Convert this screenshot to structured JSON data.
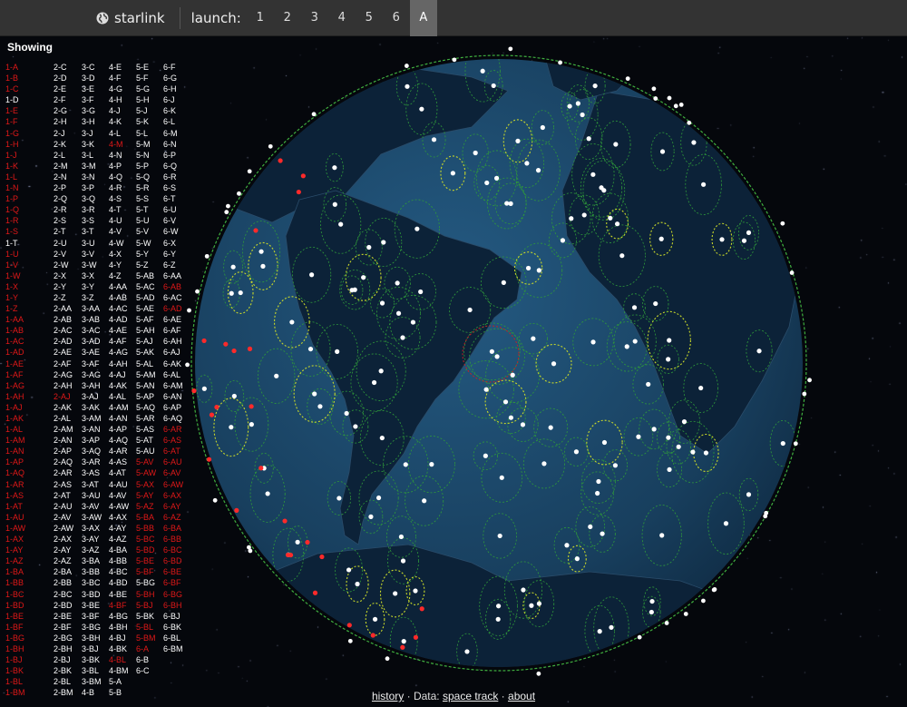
{
  "header": {
    "brand": "starlink",
    "launch_label": "launch:",
    "launch_buttons": [
      "1",
      "2",
      "3",
      "4",
      "5",
      "6",
      "A"
    ],
    "active_launch": "A"
  },
  "sidebar": {
    "heading": "Showing"
  },
  "satellite_columns": [
    [
      "1-A",
      "1-B",
      "1-C",
      "1-D",
      "1-E",
      "1-F",
      "1-G",
      "1-H",
      "1-J",
      "1-K",
      "1-L",
      "1-N",
      "1-P",
      "1-Q",
      "1-R",
      "1-S",
      "1-T",
      "1-U",
      "1-V",
      "1-W",
      "1-X",
      "1-Y",
      "1-Z",
      "1-AA",
      "1-AB",
      "1-AC",
      "1-AD",
      "1-AE",
      "1-AF",
      "1-AG",
      "1-AH",
      "1-AJ",
      "1-AK",
      "1-AL",
      "1-AM",
      "1-AN",
      "1-AP",
      "1-AQ",
      "1-AR",
      "1-AS",
      "1-AT",
      "1-AU",
      "1-AW",
      "1-AX",
      "1-AY",
      "1-AZ",
      "1-BA",
      "1-BB",
      "1-BC",
      "1-BD",
      "1-BE",
      "1-BF",
      "1-BG",
      "1-BH",
      "1-BJ",
      "1-BK",
      "1-BL",
      "1-BM"
    ],
    [
      "2-C",
      "2-D",
      "2-E",
      "2-F",
      "2-G",
      "2-H",
      "2-J",
      "2-K",
      "2-L",
      "2-M",
      "2-N",
      "2-P",
      "2-Q",
      "2-R",
      "2-S",
      "2-T",
      "2-U",
      "2-V",
      "2-W",
      "2-X",
      "2-Y",
      "2-Z",
      "2-AA",
      "2-AB",
      "2-AC",
      "2-AD",
      "2-AE",
      "2-AF",
      "2-AG",
      "2-AH",
      "2-AJ",
      "2-AK",
      "2-AL",
      "2-AM",
      "2-AN",
      "2-AP",
      "2-AQ",
      "2-AR",
      "2-AS",
      "2-AT",
      "2-AU",
      "2-AV",
      "2-AW",
      "2-AX",
      "2-AY",
      "2-AZ",
      "2-BA",
      "2-BB",
      "2-BC",
      "2-BD",
      "2-BE",
      "2-BF",
      "2-BG",
      "2-BH",
      "2-BJ",
      "2-BK",
      "2-BL",
      "2-BM"
    ],
    [
      "3-C",
      "3-D",
      "3-E",
      "3-F",
      "3-G",
      "3-H",
      "3-J",
      "3-K",
      "3-L",
      "3-M",
      "3-N",
      "3-P",
      "3-Q",
      "3-R",
      "3-S",
      "3-T",
      "3-U",
      "3-V",
      "3-W",
      "3-X",
      "3-Y",
      "3-Z",
      "3-AA",
      "3-AB",
      "3-AC",
      "3-AD",
      "3-AE",
      "3-AF",
      "3-AG",
      "3-AH",
      "3-AJ",
      "3-AK",
      "3-AM",
      "3-AN",
      "3-AP",
      "3-AQ",
      "3-AR",
      "3-AS",
      "3-AT",
      "3-AU",
      "3-AV",
      "3-AW",
      "3-AX",
      "3-AY",
      "3-AZ",
      "3-BA",
      "3-BB",
      "3-BC",
      "3-BD",
      "3-BE",
      "3-BF",
      "3-BG",
      "3-BH",
      "3-BJ",
      "3-BK",
      "3-BL",
      "3-BM",
      "4-B"
    ],
    [
      "4-E",
      "4-F",
      "4-G",
      "4-H",
      "4-J",
      "4-K",
      "4-L",
      "4-M",
      "4-N",
      "4-P",
      "4-Q",
      "4-R",
      "4-S",
      "4-T",
      "4-U",
      "4-V",
      "4-W",
      "4-X",
      "4-Y",
      "4-Z",
      "4-AA",
      "4-AB",
      "4-AC",
      "4-AD",
      "4-AE",
      "4-AF",
      "4-AG",
      "4-AH",
      "4-AJ",
      "4-AK",
      "4-AL",
      "4-AM",
      "4-AN",
      "4-AP",
      "4-AQ",
      "4-AR",
      "4-AS",
      "4-AT",
      "4-AU",
      "4-AV",
      "4-AW",
      "4-AX",
      "4-AY",
      "4-AZ",
      "4-BA",
      "4-BB",
      "4-BC",
      "4-BD",
      "4-BE",
      "4-BF",
      "4-BG",
      "4-BH",
      "4-BJ",
      "4-BK",
      "4-BL",
      "4-BM",
      "5-A",
      "5-B"
    ],
    [
      "5-E",
      "5-F",
      "5-G",
      "5-H",
      "5-J",
      "5-K",
      "5-L",
      "5-M",
      "5-N",
      "5-P",
      "5-Q",
      "5-R",
      "5-S",
      "5-T",
      "5-U",
      "5-V",
      "5-W",
      "5-Y",
      "5-Z",
      "5-AB",
      "5-AC",
      "5-AD",
      "5-AE",
      "5-AF",
      "5-AH",
      "5-AJ",
      "5-AK",
      "5-AL",
      "5-AM",
      "5-AN",
      "5-AP",
      "5-AQ",
      "5-AR",
      "5-AS",
      "5-AT",
      "5-AU",
      "5-AV",
      "5-AW",
      "5-AX",
      "5-AY",
      "5-AZ",
      "5-BA",
      "5-BB",
      "5-BC",
      "5-BD",
      "5-BE",
      "5-BF",
      "5-BG",
      "5-BH",
      "5-BJ",
      "5-BK",
      "5-BL",
      "5-BM",
      "6-A",
      "6-B",
      "6-C"
    ],
    [
      "6-F",
      "6-G",
      "6-H",
      "6-J",
      "6-K",
      "6-L",
      "6-M",
      "6-N",
      "6-P",
      "6-Q",
      "6-R",
      "6-S",
      "6-T",
      "6-U",
      "6-V",
      "6-W",
      "6-X",
      "6-Y",
      "6-Z",
      "6-AA",
      "6-AB",
      "6-AC",
      "6-AD",
      "6-AE",
      "6-AF",
      "6-AH",
      "6-AJ",
      "6-AK",
      "6-AL",
      "6-AM",
      "6-AN",
      "6-AP",
      "6-AQ",
      "6-AR",
      "6-AS",
      "6-AT",
      "6-AU",
      "6-AV",
      "6-AW",
      "6-AX",
      "6-AY",
      "6-AZ",
      "6-BA",
      "6-BB",
      "6-BC",
      "6-BD",
      "6-BE",
      "6-BF",
      "6-BG",
      "6-BH",
      "6-BJ",
      "6-BK",
      "6-BL",
      "6-BM"
    ]
  ],
  "hidden_satellites": [
    "1-A",
    "1-B",
    "1-C",
    "1-E",
    "1-F",
    "1-G",
    "1-H",
    "1-J",
    "1-K",
    "1-L",
    "1-N",
    "1-P",
    "1-Q",
    "1-R",
    "1-S",
    "1-U",
    "1-V",
    "1-W",
    "1-X",
    "1-Y",
    "1-Z",
    "1-AA",
    "1-AB",
    "1-AC",
    "1-AD",
    "1-AE",
    "1-AF",
    "1-AG",
    "1-AH",
    "1-AJ",
    "1-AK",
    "1-AL",
    "1-AM",
    "1-AN",
    "1-AP",
    "1-AQ",
    "1-AR",
    "1-AS",
    "1-AT",
    "1-AU",
    "1-AW",
    "1-AX",
    "1-AY",
    "1-AZ",
    "1-BA",
    "1-BB",
    "1-BC",
    "1-BD",
    "1-BE",
    "1-BF",
    "1-BG",
    "1-BH",
    "1-BJ",
    "1-BK",
    "1-BL",
    "1-BM",
    "2-AJ",
    "4-M",
    "4-BF",
    "4-BL",
    "5-AV",
    "5-AW",
    "5-AX",
    "5-AY",
    "5-AZ",
    "5-BA",
    "5-BB",
    "5-BC",
    "5-BD",
    "5-BE",
    "5-BF",
    "5-BH",
    "5-BJ",
    "5-BL",
    "5-BM",
    "6-A",
    "6-AB",
    "6-AD",
    "6-AR",
    "6-AS",
    "6-AT",
    "6-AU",
    "6-AV",
    "6-AW",
    "6-AX",
    "6-AY",
    "6-AZ",
    "6-BA",
    "6-BB",
    "6-BC",
    "6-BD",
    "6-BE",
    "6-BF",
    "6-BG",
    "6-BH"
  ],
  "colors": {
    "visible_label": "#ffffff",
    "hidden_label": "#e01818",
    "ocean": "#1d4a6c",
    "land": "#0c2238",
    "footprint_active": "#c8d82a",
    "footprint_idle": "#2f9a3a",
    "satellite": "#ffffff",
    "satellite_hidden": "#ff2a2a"
  },
  "footer": {
    "history": "history",
    "separator1": " · Data: ",
    "space_track": "space track",
    "separator2": " · ",
    "about": "about"
  }
}
